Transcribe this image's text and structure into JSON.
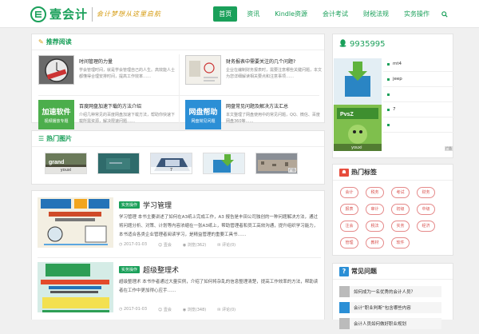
{
  "header": {
    "logo_text": "壹会计",
    "slogan": "会计梦想从这里启航",
    "nav": [
      "首页",
      "资讯",
      "Kindle资源",
      "会计考试",
      "财税法规",
      "实务操作"
    ],
    "search_icon": "search-icon"
  },
  "recommend": {
    "title": "推荐阅读",
    "items": [
      {
        "title": "时间管理的力量",
        "desc": "学会管理时间，就是学会管理自己的人生。高效能人士都懂得合理安排时间，提高工作效率……"
      },
      {
        "title": "财务报表中需要关注的几个问题?",
        "desc": "企业在编制财务报表时，需要注意哪些关键问题，本文为您详细解读相关要点和注意事项……"
      },
      {
        "title": "百度网盘加速下载的方法介绍",
        "desc": "介绍几种常见的百度网盘加速下载方法，帮助你快速下载所需资源，解决限速问题……"
      },
      {
        "title": "网盘常见问题及解决方法汇总",
        "desc": "本文整理了网盘使用中的常见问题，QQ、微信、百度网盘360等……"
      }
    ],
    "badge1": {
      "line1": "加速软件",
      "line2": "视频播放专题"
    },
    "badge2": {
      "line1": "网盘帮助",
      "line2": "网盘常见问题"
    }
  },
  "hot": {
    "title": "热门图片",
    "captions": [
      "youxi",
      "",
      "7",
      "",
      ""
    ],
    "ad_label": "广告"
  },
  "articles": [
    {
      "category": "实务操作",
      "title": "学习管理",
      "desc": "学习管理 本书主要讲述了如何在A3纸上完成工作，A3 报告是丰田公司独创的一种问题解决方法，通过将问题分析、对策、计划等内容浓缩在一张A3纸上，帮助管理者和员工高效沟通，提升组织学习能力，本书适合各类企业管理者阅读学习，是精益管理的重要工具书……",
      "date": "2017-01-03",
      "author": "壹会",
      "views": "浏览(362)",
      "comments": "评论(0)"
    },
    {
      "category": "实务操作",
      "title": "超级整理术",
      "desc": "超级整理术 本书作者通过大量实例，介绍了如何将杂乱的信息整理清楚，提高工作效率的方法，帮助读者在工作中更加得心应手……",
      "date": "2017-01-03",
      "author": "壹会",
      "views": "浏览(348)",
      "comments": "评论(0)"
    }
  ],
  "sidebar": {
    "qq": "9935995",
    "slider_items": [
      "mt4",
      "jeep",
      "",
      "7",
      ""
    ],
    "slider_caption": "youxi",
    "ad_label": "广告",
    "tags_title": "热门标签",
    "tags": [
      "会计",
      "税务",
      "考试",
      "财务",
      "报表",
      "审计",
      "初级",
      "中级",
      "注会",
      "税法",
      "实务",
      "经济",
      "管理",
      "教材",
      "软件"
    ],
    "faq_title": "常见问题",
    "faq": [
      "如何成为一名优秀的会计人员？",
      "会计“职业判断”包含哪些内容",
      "会计人员如何做好职业规划"
    ]
  },
  "colors": {
    "brand": "#1aa05a",
    "tag_red": "#d9534f",
    "faq_blue": "#2b8fd6"
  }
}
